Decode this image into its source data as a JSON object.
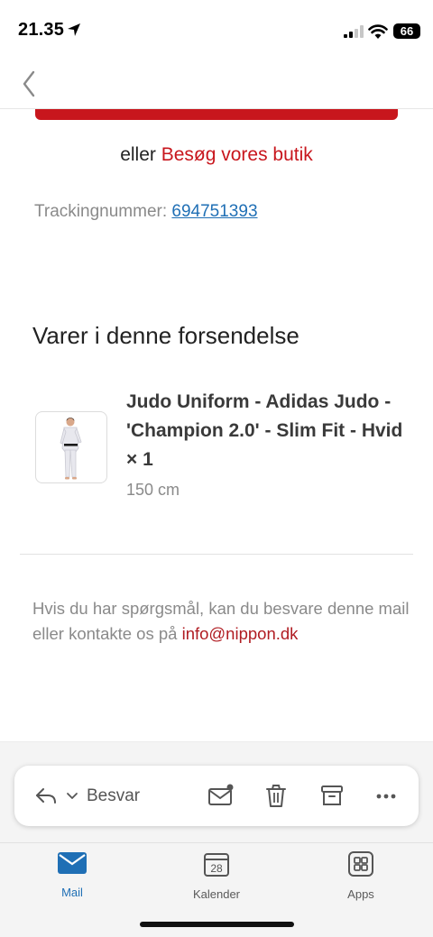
{
  "status_bar": {
    "time": "21.35",
    "battery": "66"
  },
  "email": {
    "visit_prefix": "eller",
    "visit_link": "Besøg vores butik",
    "tracking_label": "Trackingnummer:",
    "tracking_number": "694751393",
    "section_title": "Varer i denne forsendelse",
    "product": {
      "name": "Judo Uniform - Adidas Judo - 'Champion 2.0' - Slim Fit - Hvid × 1",
      "size": "150 cm"
    },
    "help_text": "Hvis du har spørgsmål, kan du besvare denne mail eller kontakte os på",
    "help_email": "info@nippon.dk"
  },
  "toolbar": {
    "reply_label": "Besvar"
  },
  "tabs": [
    {
      "label": "Mail",
      "icon": "mail-icon",
      "active": true
    },
    {
      "label": "Kalender",
      "icon": "calendar-icon",
      "badge": "28"
    },
    {
      "label": "Apps",
      "icon": "apps-icon"
    }
  ],
  "colors": {
    "accent_red": "#c8161d",
    "link_blue": "#1f6fb5",
    "tab_active": "#1f6fb5"
  }
}
